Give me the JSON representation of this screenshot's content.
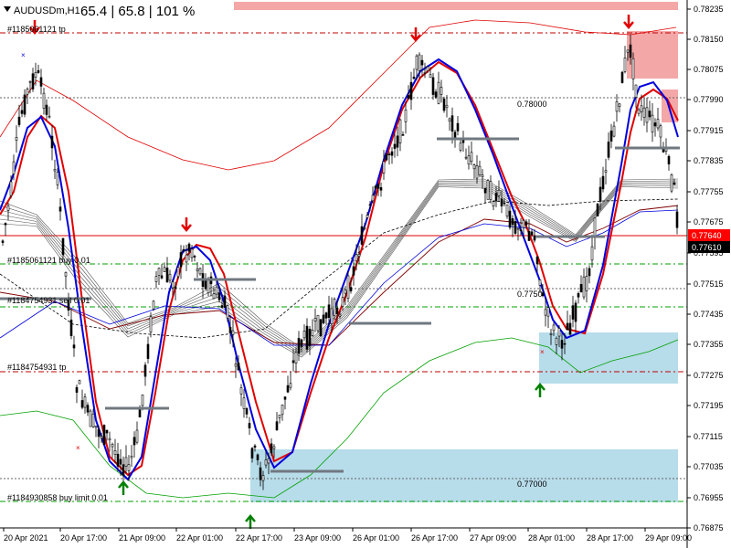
{
  "header": {
    "symbol": "AUDUSDm,H1",
    "stats": "65.4 | 65.8 | 101 %",
    "menu_icon": "dropdown-triangle-icon"
  },
  "price_axis": {
    "ticks": [
      "0.78235",
      "0.78150",
      "0.78075",
      "0.77990",
      "0.77915",
      "0.77835",
      "0.77755",
      "0.77675",
      "0.77595",
      "0.77515",
      "0.77435",
      "0.77355",
      "0.77275",
      "0.77195",
      "0.77115",
      "0.77035",
      "0.76955",
      "0.76875"
    ],
    "tags": [
      {
        "price": "0.77640",
        "bg": "#ff0000",
        "fg": "#ffffff"
      },
      {
        "price": "0.77610",
        "bg": "#000000",
        "fg": "#ffffff"
      }
    ]
  },
  "time_axis": {
    "labels": [
      "20 Apr 2021",
      "20 Apr 17:00",
      "21 Apr 09:00",
      "22 Apr 01:00",
      "22 Apr 17:00",
      "23 Apr 09:00",
      "26 Apr 01:00",
      "26 Apr 17:00",
      "27 Apr 09:00",
      "28 Apr 01:00",
      "28 Apr 17:00",
      "29 Apr 09:00"
    ]
  },
  "order_lines": [
    {
      "label": "#1185061121 tp",
      "color": "#c00000"
    },
    {
      "label": "#1185061121 buy 0.01",
      "color": "#00a000"
    },
    {
      "label": "#1184754931 sell 0.01",
      "color": "#c00000"
    },
    {
      "label": "#1184754931 tp",
      "color": "#c00000"
    },
    {
      "label": "#1184930858 buy limit 0.01",
      "color": "#00a000"
    }
  ],
  "level_labels": [
    "0.78000",
    "0.7750",
    "0.77000"
  ],
  "colors": {
    "bull_candle": "#000000",
    "bear_candle": "#000000",
    "blue_ma": "#0000dd",
    "red_ma": "#e00000",
    "arrow_up": "#008000",
    "arrow_down": "#e00000",
    "zone_red": "#f4a7a7",
    "zone_blue": "#b7dcea"
  },
  "signals": {
    "up_arrow_icon": "green-up-arrow-icon",
    "down_arrow_icon": "red-down-arrow-icon",
    "cross_marker_icon": "cross-marker-icon"
  }
}
